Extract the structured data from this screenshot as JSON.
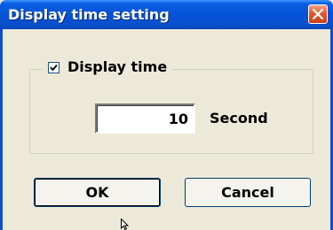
{
  "dialog": {
    "title": "Display time setting"
  },
  "display_time": {
    "checkbox_label": "Display time",
    "checked": true,
    "value": "10",
    "unit": "Second"
  },
  "buttons": {
    "ok_label": "OK",
    "cancel_label": "Cancel"
  },
  "icons": {
    "close": "close-icon",
    "check": "check-icon",
    "cursor": "mouse-cursor-icon"
  },
  "colors": {
    "titlebar": "#0552d6",
    "close_button": "#e1582d",
    "dialog_background": "#ece9d8"
  }
}
